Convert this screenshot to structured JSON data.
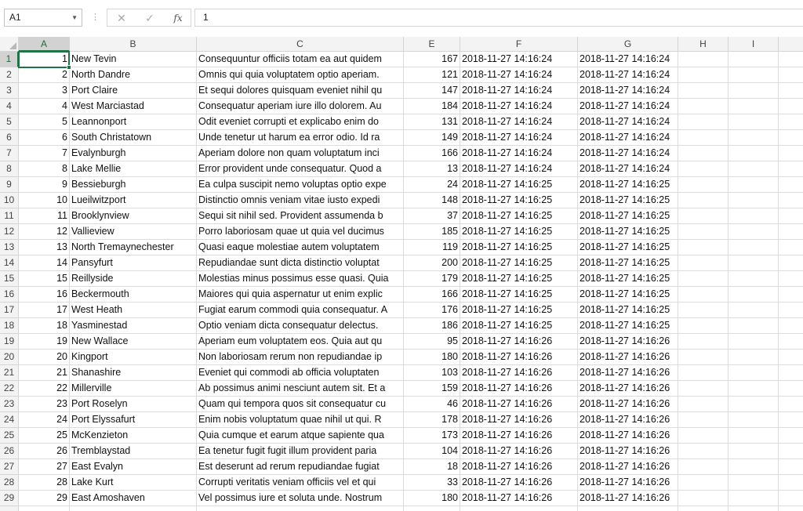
{
  "formula_bar": {
    "name_box": "A1",
    "separator": "⋮",
    "cancel_glyph": "✕",
    "enter_glyph": "✓",
    "fx_glyph": "fx",
    "value": "1"
  },
  "columns": [
    "A",
    "B",
    "C",
    "E",
    "F",
    "G",
    "H",
    "I"
  ],
  "rows": [
    {
      "n": "1",
      "a": "1",
      "b": "New Tevin",
      "c": "Consequuntur officiis totam ea aut quidem",
      "e": "167",
      "f": "2018-11-27 14:16:24",
      "g": "2018-11-27 14:16:24"
    },
    {
      "n": "2",
      "a": "2",
      "b": "North Dandre",
      "c": "Omnis qui quia voluptatem optio aperiam.",
      "e": "121",
      "f": "2018-11-27 14:16:24",
      "g": "2018-11-27 14:16:24"
    },
    {
      "n": "3",
      "a": "3",
      "b": "Port Claire",
      "c": "Et sequi dolores quisquam eveniet nihil qu",
      "e": "147",
      "f": "2018-11-27 14:16:24",
      "g": "2018-11-27 14:16:24"
    },
    {
      "n": "4",
      "a": "4",
      "b": "West Marciastad",
      "c": "Consequatur aperiam iure illo dolorem. Au",
      "e": "184",
      "f": "2018-11-27 14:16:24",
      "g": "2018-11-27 14:16:24"
    },
    {
      "n": "5",
      "a": "5",
      "b": "Leannonport",
      "c": "Odit eveniet corrupti et explicabo enim do",
      "e": "131",
      "f": "2018-11-27 14:16:24",
      "g": "2018-11-27 14:16:24"
    },
    {
      "n": "6",
      "a": "6",
      "b": "South Christatown",
      "c": "Unde tenetur ut harum ea error odio. Id ra",
      "e": "149",
      "f": "2018-11-27 14:16:24",
      "g": "2018-11-27 14:16:24"
    },
    {
      "n": "7",
      "a": "7",
      "b": "Evalynburgh",
      "c": "Aperiam dolore non quam voluptatum inci",
      "e": "166",
      "f": "2018-11-27 14:16:24",
      "g": "2018-11-27 14:16:24"
    },
    {
      "n": "8",
      "a": "8",
      "b": "Lake Mellie",
      "c": "Error provident unde consequatur. Quod a",
      "e": "13",
      "f": "2018-11-27 14:16:24",
      "g": "2018-11-27 14:16:24"
    },
    {
      "n": "9",
      "a": "9",
      "b": "Bessieburgh",
      "c": "Ea culpa suscipit nemo voluptas optio expe",
      "e": "24",
      "f": "2018-11-27 14:16:25",
      "g": "2018-11-27 14:16:25"
    },
    {
      "n": "10",
      "a": "10",
      "b": "Lueilwitzport",
      "c": "Distinctio omnis veniam vitae iusto expedi",
      "e": "148",
      "f": "2018-11-27 14:16:25",
      "g": "2018-11-27 14:16:25"
    },
    {
      "n": "11",
      "a": "11",
      "b": "Brooklynview",
      "c": "Sequi sit nihil sed. Provident assumenda b",
      "e": "37",
      "f": "2018-11-27 14:16:25",
      "g": "2018-11-27 14:16:25"
    },
    {
      "n": "12",
      "a": "12",
      "b": "Vallieview",
      "c": "Porro laboriosam quae ut quia vel ducimus",
      "e": "185",
      "f": "2018-11-27 14:16:25",
      "g": "2018-11-27 14:16:25"
    },
    {
      "n": "13",
      "a": "13",
      "b": "North Tremaynechester",
      "c": "Quasi eaque molestiae autem voluptatem",
      "e": "119",
      "f": "2018-11-27 14:16:25",
      "g": "2018-11-27 14:16:25"
    },
    {
      "n": "14",
      "a": "14",
      "b": "Pansyfurt",
      "c": "Repudiandae sunt dicta distinctio voluptat",
      "e": "200",
      "f": "2018-11-27 14:16:25",
      "g": "2018-11-27 14:16:25"
    },
    {
      "n": "15",
      "a": "15",
      "b": "Reillyside",
      "c": "Molestias minus possimus esse quasi. Quia",
      "e": "179",
      "f": "2018-11-27 14:16:25",
      "g": "2018-11-27 14:16:25"
    },
    {
      "n": "16",
      "a": "16",
      "b": "Beckermouth",
      "c": "Maiores qui quia aspernatur ut enim explic",
      "e": "166",
      "f": "2018-11-27 14:16:25",
      "g": "2018-11-27 14:16:25"
    },
    {
      "n": "17",
      "a": "17",
      "b": "West Heath",
      "c": "Fugiat earum commodi quia consequatur. A",
      "e": "176",
      "f": "2018-11-27 14:16:25",
      "g": "2018-11-27 14:16:25"
    },
    {
      "n": "18",
      "a": "18",
      "b": "Yasminestad",
      "c": "Optio veniam dicta consequatur delectus.",
      "e": "186",
      "f": "2018-11-27 14:16:25",
      "g": "2018-11-27 14:16:25"
    },
    {
      "n": "19",
      "a": "19",
      "b": "New Wallace",
      "c": "Aperiam eum voluptatem eos. Quia aut qu",
      "e": "95",
      "f": "2018-11-27 14:16:26",
      "g": "2018-11-27 14:16:26"
    },
    {
      "n": "20",
      "a": "20",
      "b": "Kingport",
      "c": "Non laboriosam rerum non repudiandae ip",
      "e": "180",
      "f": "2018-11-27 14:16:26",
      "g": "2018-11-27 14:16:26"
    },
    {
      "n": "21",
      "a": "21",
      "b": "Shanashire",
      "c": "Eveniet qui commodi ab officia voluptaten",
      "e": "103",
      "f": "2018-11-27 14:16:26",
      "g": "2018-11-27 14:16:26"
    },
    {
      "n": "22",
      "a": "22",
      "b": "Millerville",
      "c": "Ab possimus animi nesciunt autem sit. Et a",
      "e": "159",
      "f": "2018-11-27 14:16:26",
      "g": "2018-11-27 14:16:26"
    },
    {
      "n": "23",
      "a": "23",
      "b": "Port Roselyn",
      "c": "Quam qui tempora quos sit consequatur cu",
      "e": "46",
      "f": "2018-11-27 14:16:26",
      "g": "2018-11-27 14:16:26"
    },
    {
      "n": "24",
      "a": "24",
      "b": "Port Elyssafurt",
      "c": "Enim nobis voluptatum quae nihil ut qui. R",
      "e": "178",
      "f": "2018-11-27 14:16:26",
      "g": "2018-11-27 14:16:26"
    },
    {
      "n": "25",
      "a": "25",
      "b": "McKenzieton",
      "c": "Quia cumque et earum atque sapiente qua",
      "e": "173",
      "f": "2018-11-27 14:16:26",
      "g": "2018-11-27 14:16:26"
    },
    {
      "n": "26",
      "a": "26",
      "b": "Tremblaystad",
      "c": "Ea tenetur fugit fugit illum provident paria",
      "e": "104",
      "f": "2018-11-27 14:16:26",
      "g": "2018-11-27 14:16:26"
    },
    {
      "n": "27",
      "a": "27",
      "b": "East Evalyn",
      "c": "Est deserunt ad rerum repudiandae fugiat",
      "e": "18",
      "f": "2018-11-27 14:16:26",
      "g": "2018-11-27 14:16:26"
    },
    {
      "n": "28",
      "a": "28",
      "b": "Lake Kurt",
      "c": "Corrupti veritatis veniam officiis vel et qui",
      "e": "33",
      "f": "2018-11-27 14:16:26",
      "g": "2018-11-27 14:16:26"
    },
    {
      "n": "29",
      "a": "29",
      "b": "East Amoshaven",
      "c": "Vel possimus iure et soluta unde. Nostrum",
      "e": "180",
      "f": "2018-11-27 14:16:26",
      "g": "2018-11-27 14:16:26"
    }
  ],
  "selection": {
    "cell": "A1"
  },
  "colors": {
    "accent": "#217346",
    "header_bg": "#f3f3f3",
    "header_active_bg": "#d2d2d2",
    "gridline": "#dcdcdc"
  }
}
